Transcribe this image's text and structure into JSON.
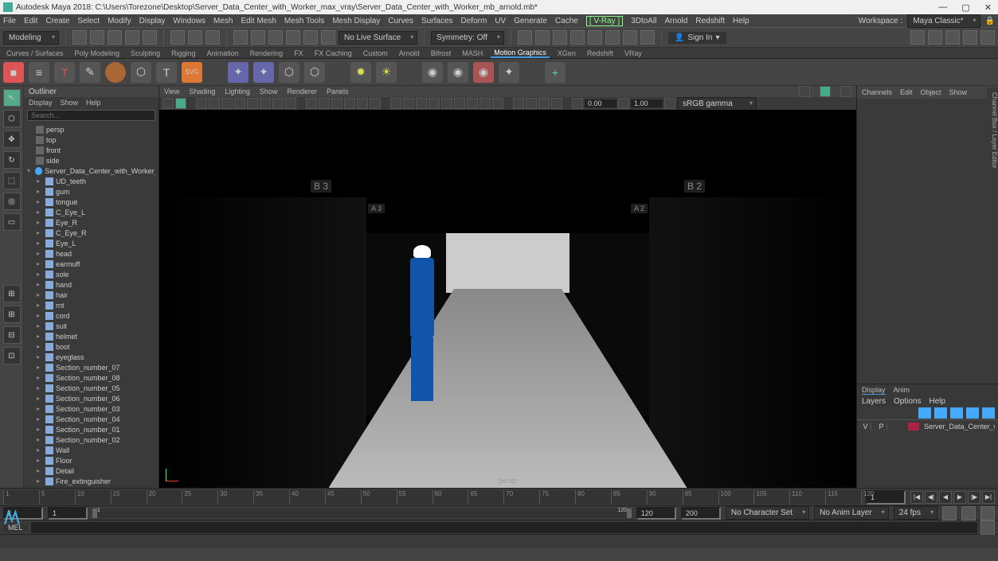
{
  "titlebar": {
    "app": "Autodesk Maya 2018: C:\\Users\\Torezone\\Desktop\\Server_Data_Center_with_Worker_max_vray\\Server_Data_Center_with_Worker_mb_arnold.mb*"
  },
  "menubar": {
    "items": [
      "File",
      "Edit",
      "Create",
      "Select",
      "Modify",
      "Display",
      "Windows",
      "Mesh",
      "Edit Mesh",
      "Mesh Tools",
      "Mesh Display",
      "Curves",
      "Surfaces",
      "Deform",
      "UV",
      "Generate",
      "Cache"
    ],
    "vray": "[ V-Ray ]",
    "extras": [
      "3DtoAll",
      "Arnold",
      "Redshift",
      "Help"
    ],
    "workspace_label": "Workspace :",
    "workspace": "Maya Classic*"
  },
  "toolbar": {
    "mode": "Modeling",
    "live": "No Live Surface",
    "symmetry": "Symmetry: Off",
    "signin": "Sign In"
  },
  "shelf": {
    "tabs": [
      "Curves / Surfaces",
      "Poly Modeling",
      "Sculpting",
      "Rigging",
      "Animation",
      "Rendering",
      "FX",
      "FX Caching",
      "Custom",
      "Arnold",
      "Bifrost",
      "MASH",
      "Motion Graphics",
      "XGen",
      "Redshift",
      "VRay"
    ],
    "active": "Motion Graphics"
  },
  "outliner": {
    "title": "Outliner",
    "menu": [
      "Display",
      "Show",
      "Help"
    ],
    "search_ph": "Search...",
    "cameras": [
      "persp",
      "top",
      "front",
      "side"
    ],
    "root": "Server_Data_Center_with_Worker_ncl",
    "items": [
      "UD_teeth",
      "gum",
      "tongue",
      "C_Eye_L",
      "Eye_R",
      "C_Eye_R",
      "Eye_L",
      "head",
      "earmuff",
      "sole",
      "hand",
      "hair",
      "rnt",
      "cord",
      "suit",
      "helmet",
      "boot",
      "eyeglass",
      "Section_number_07",
      "Section_number_08",
      "Section_number_05",
      "Section_number_06",
      "Section_number_03",
      "Section_number_04",
      "Section_number_01",
      "Section_number_02",
      "Wall",
      "Floor",
      "Detail",
      "Fire_extinguisher"
    ]
  },
  "viewport": {
    "menu": [
      "View",
      "Shading",
      "Lighting",
      "Show",
      "Renderer",
      "Panels"
    ],
    "near": "0.00",
    "far": "1.00",
    "gamma": "sRGB gamma",
    "camera": "persp",
    "labels": {
      "b3": "B 3",
      "b2": "B 2",
      "a3": "A 3",
      "a2": "A 2"
    }
  },
  "rightpanel": {
    "tabs": [
      "Channels",
      "Edit",
      "Object",
      "Show"
    ],
    "btabs": [
      "Display",
      "Anim"
    ],
    "btabs2": [
      "Layers",
      "Options",
      "Help"
    ],
    "layer": {
      "v": "V",
      "p": "P",
      "name": "Server_Data_Center_with_Wor"
    }
  },
  "sidetab": "Channel Box / Layer Editor",
  "timeline": {
    "ticks": [
      "1",
      "5",
      "10",
      "15",
      "20",
      "25",
      "30",
      "35",
      "40",
      "45",
      "50",
      "55",
      "60",
      "65",
      "70",
      "75",
      "80",
      "85",
      "90",
      "95",
      "100",
      "105",
      "110",
      "115",
      "120"
    ],
    "current": "1"
  },
  "range": {
    "start1": "1",
    "start2": "1",
    "slider_start": "1",
    "slider_end": "120",
    "end1": "120",
    "end2": "200",
    "charset": "No Character Set",
    "animlayer": "No Anim Layer",
    "fps": "24 fps"
  },
  "cmd": {
    "label": "MEL"
  }
}
